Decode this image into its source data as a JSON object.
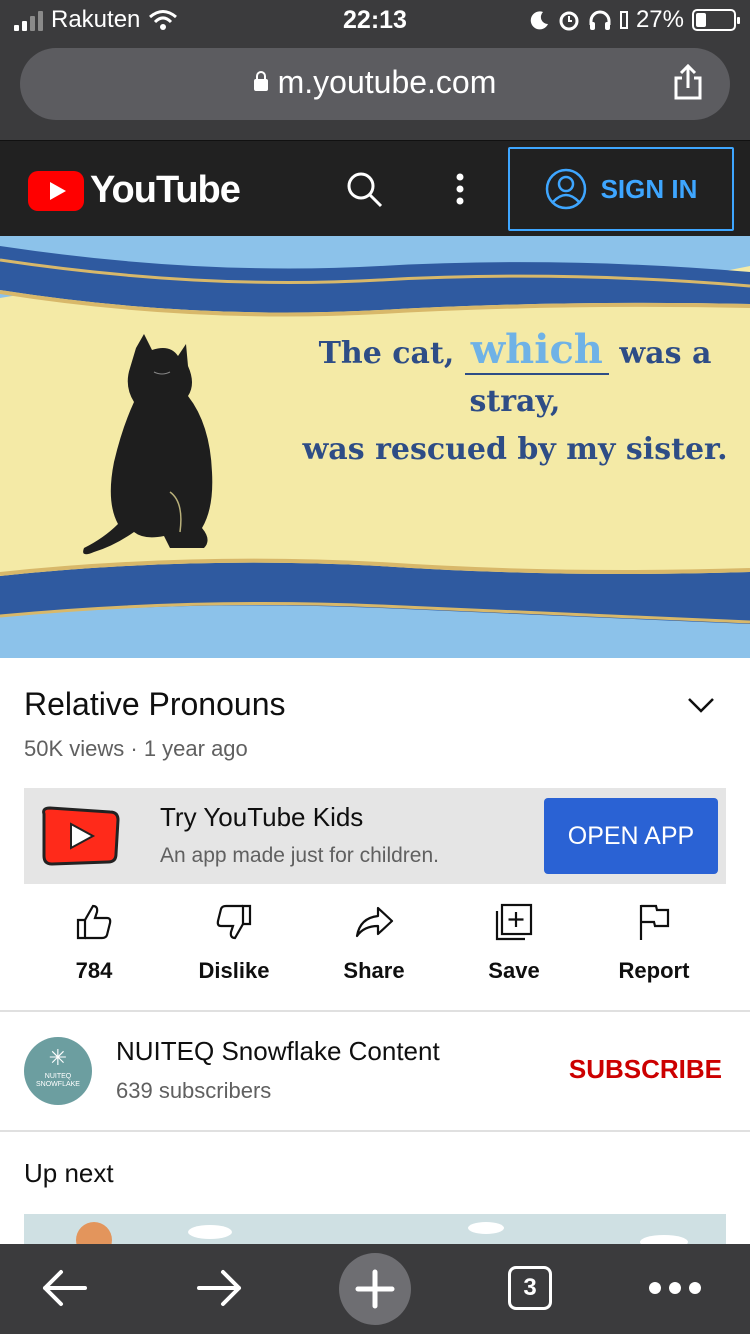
{
  "status_bar": {
    "carrier": "Rakuten",
    "time": "22:13",
    "battery": "27%"
  },
  "browser": {
    "url": "m.youtube.com",
    "tab_count": "3"
  },
  "header": {
    "logo_text": "YouTube",
    "sign_in_label": "SIGN IN"
  },
  "video": {
    "caption_part1": "The cat,",
    "caption_blank": "which",
    "caption_part2": "was a stray,",
    "caption_line2": "was rescued by my sister.",
    "title": "Relative Pronouns",
    "meta": "50K views · 1 year ago"
  },
  "kids_promo": {
    "title": "Try YouTube Kids",
    "subtitle": "An app made just for children.",
    "button_label": "OPEN APP"
  },
  "actions": [
    {
      "label": "784",
      "icon": "thumbs-up-icon"
    },
    {
      "label": "Dislike",
      "icon": "thumbs-down-icon"
    },
    {
      "label": "Share",
      "icon": "share-arrow-icon"
    },
    {
      "label": "Save",
      "icon": "add-to-playlist-icon"
    },
    {
      "label": "Report",
      "icon": "flag-icon"
    }
  ],
  "channel": {
    "name": "NUITEQ Snowflake Content",
    "subscribers": "639 subscribers",
    "subscribe_label": "SUBSCRIBE",
    "avatar_text": "NUITEQ SNOWFLAKE"
  },
  "up_next": {
    "heading": "Up next"
  },
  "colors": {
    "youtube_red": "#ff0000",
    "sign_in_blue": "#3ea6ff",
    "open_app_blue": "#2a62d4",
    "subscribe_red": "#cc0000",
    "header_dark": "#212121",
    "browser_chrome": "#3b3b3d"
  }
}
